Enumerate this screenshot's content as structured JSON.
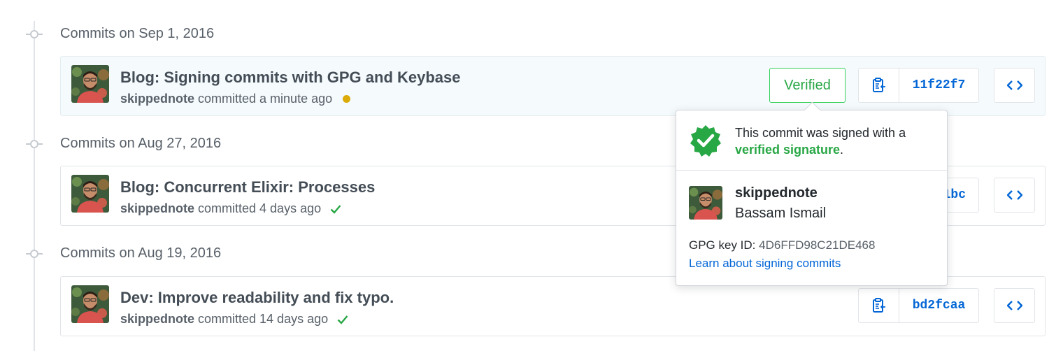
{
  "groups": [
    {
      "title": "Commits on Sep 1, 2016",
      "commit": {
        "title": "Blog: Signing commits with GPG and Keybase",
        "author": "skippednote",
        "time": "committed a minute ago",
        "status": "pending",
        "verified_label": "Verified",
        "sha": "11f22f7"
      }
    },
    {
      "title": "Commits on Aug 27, 2016",
      "commit": {
        "title": "Blog: Concurrent Elixir: Processes",
        "author": "skippednote",
        "time": "committed 4 days ago",
        "status": "success",
        "sha_visible": "1bc"
      }
    },
    {
      "title": "Commits on Aug 19, 2016",
      "commit": {
        "title": "Dev: Improve readability and fix typo.",
        "author": "skippednote",
        "time": "committed 14 days ago",
        "status": "success",
        "sha": "bd2fcaa"
      }
    }
  ],
  "popover": {
    "message_prefix": "This commit was signed with a",
    "message_highlight": "verified signature",
    "message_suffix": ".",
    "username": "skippednote",
    "full_name": "Bassam Ismail",
    "key_label": "GPG key ID:",
    "key_id": "4D6FFD98C21DE468",
    "link": "Learn about signing commits"
  },
  "icons": {
    "copy": "clipboard-icon",
    "browse": "code-icon",
    "check": "check-icon",
    "badge": "verified-badge-icon"
  },
  "colors": {
    "green": "#28a745",
    "link": "#0366d6",
    "pending": "#dbab09"
  }
}
